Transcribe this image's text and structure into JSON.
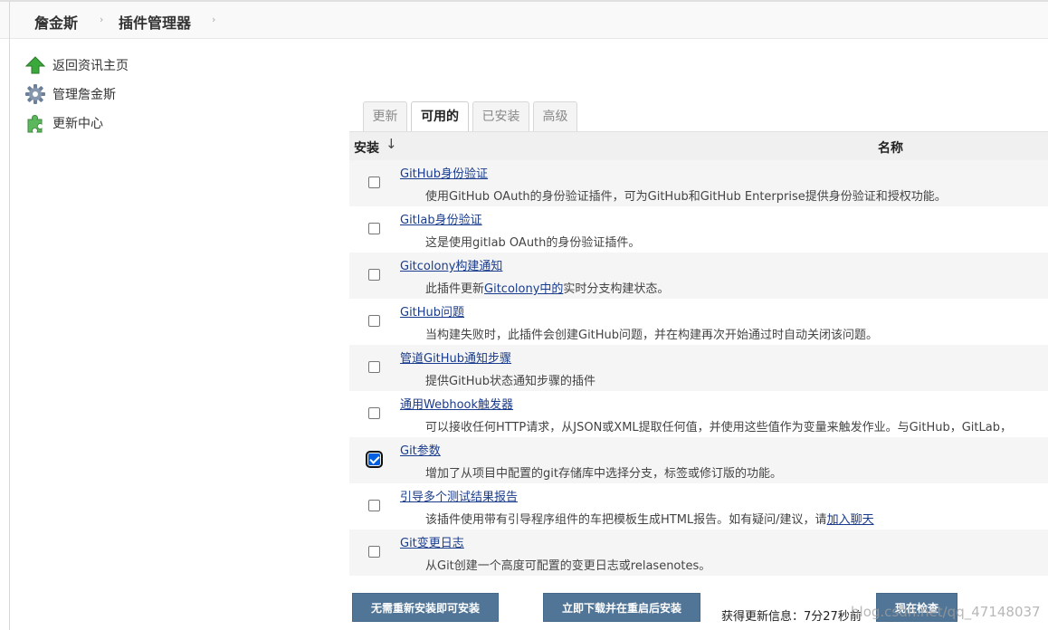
{
  "breadcrumb": {
    "root": "詹金斯",
    "current": "插件管理器",
    "separator": "›"
  },
  "sidebar": {
    "items": [
      {
        "label": "返回资讯主页",
        "icon": "up-arrow-icon"
      },
      {
        "label": "管理詹金斯",
        "icon": "gear-icon"
      },
      {
        "label": "更新中心",
        "icon": "puzzle-icon"
      }
    ]
  },
  "tabs": [
    {
      "label": "更新",
      "active": false
    },
    {
      "label": "可用的",
      "active": true
    },
    {
      "label": "已安装",
      "active": false
    },
    {
      "label": "高级",
      "active": false
    }
  ],
  "table": {
    "col_install": "安装",
    "sort_indicator": "↓",
    "col_name": "名称",
    "rows": [
      {
        "name": "GitHub身份验证",
        "desc": "使用GitHub OAuth的身份验证插件，可为GitHub和GitHub Enterprise提供身份验证和授权功能。",
        "checked": false
      },
      {
        "name": "Gitlab身份验证",
        "desc": "这是使用gitlab OAuth的身份验证插件。",
        "checked": false
      },
      {
        "name": "Gitcolony构建通知",
        "desc_pre": "此插件更新",
        "desc_link": "Gitcolony中的",
        "desc_post": "实时分支构建状态。",
        "checked": false
      },
      {
        "name": "GitHub问题",
        "desc": "当构建失败时，此插件会创建GitHub问题，并在构建再次开始通过时自动关闭该问题。",
        "checked": false
      },
      {
        "name": "管道GitHub通知步骤",
        "desc": "提供GitHub状态通知步骤的插件",
        "checked": false
      },
      {
        "name": "通用Webhook触发器",
        "desc": "可以接收任何HTTP请求，从JSON或XML提取任何值，并使用这些值作为变量来触发作业。与GitHub，GitLab，",
        "checked": false
      },
      {
        "name": "Git参数",
        "desc": "增加了从项目中配置的git存储库中选择分支，标签或修订版的功能。",
        "checked": true
      },
      {
        "name": "引导多个测试结果报告",
        "desc_pre": "该插件使用带有引导程序组件的车把模板生成HTML报告。如有疑问/建议，请",
        "desc_link": "加入聊天",
        "desc_post": "",
        "checked": false
      },
      {
        "name": "Git变更日志",
        "desc": "从Git创建一个高度可配置的变更日志或relasenotes。",
        "checked": false
      }
    ]
  },
  "footer": {
    "install_no_restart": "无需重新安装即可安装",
    "download_restart": "立即下载并在重启后安装",
    "update_info": "获得更新信息：7分27秒前",
    "check_now": "现在检查",
    "watermark": "blog.csdn.net/qq_47148037"
  },
  "colors": {
    "button": "#517597",
    "link": "#1a3c8c",
    "checkbox_checked": "#0060df"
  }
}
